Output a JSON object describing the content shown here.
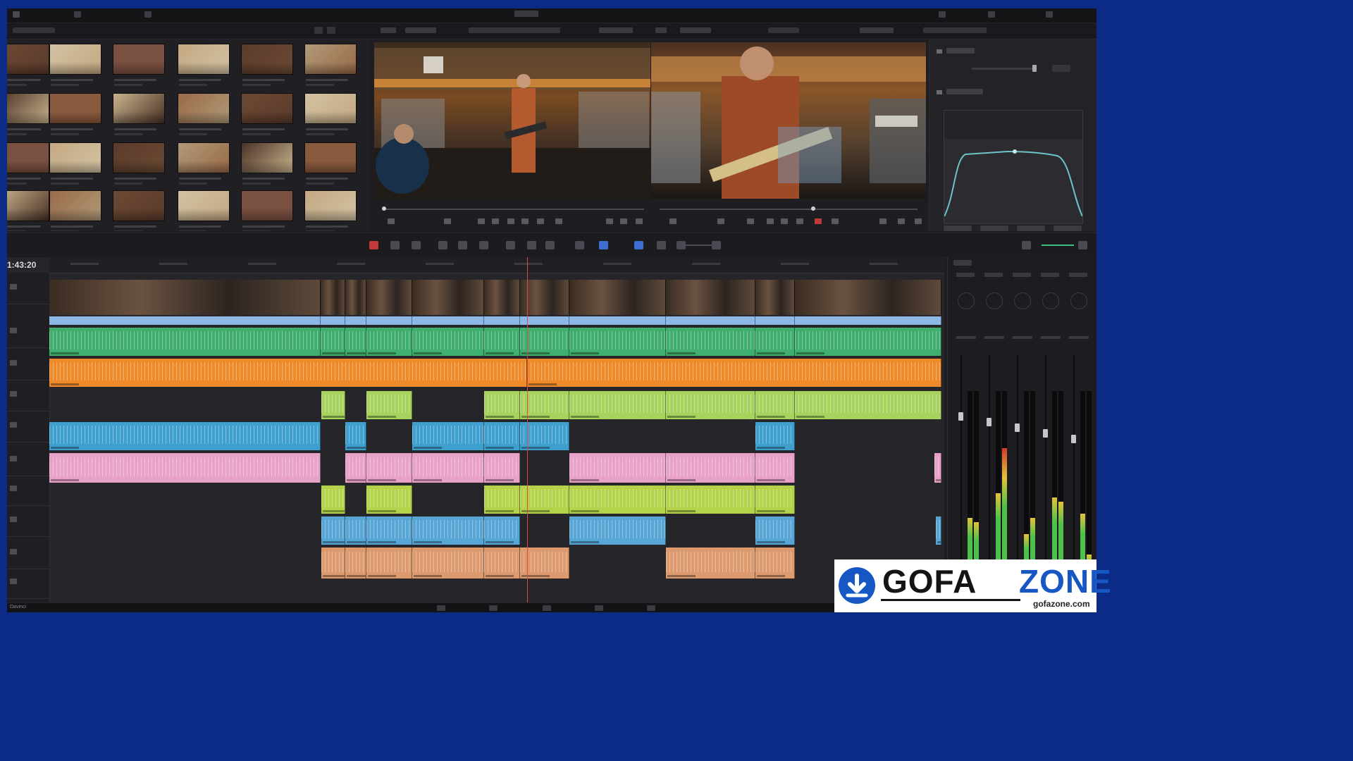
{
  "app": {
    "page_title": "Davinci",
    "timecode": "1:43:20"
  },
  "logo": {
    "word1": "GOFA",
    "word2": "ZONE",
    "site": "gofazone.com"
  },
  "colors": {
    "video_label": "#8db8e6",
    "a1": "#3fae6e",
    "a2": "#ee8a2a",
    "a3": "#a7d25e",
    "a4": "#3f9fcf",
    "a5": "#e8a2c9",
    "a6": "#b4d34a",
    "a7": "#57a6d6",
    "a8": "#dc9a6e",
    "brand_blue": "#1657c4"
  }
}
